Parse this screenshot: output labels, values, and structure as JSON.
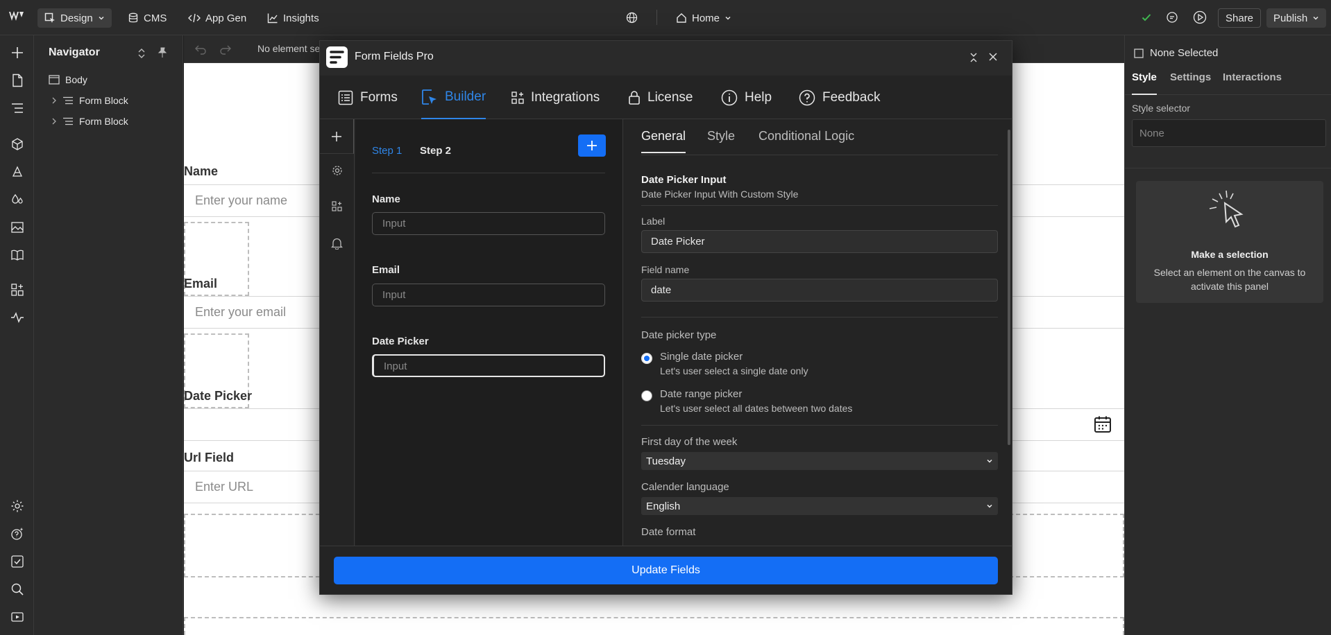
{
  "topbar": {
    "design_label": "Design",
    "cms_label": "CMS",
    "appgen_label": "App Gen",
    "insights_label": "Insights",
    "page_label": "Home",
    "share_label": "Share",
    "publish_label": "Publish"
  },
  "navigator": {
    "title": "Navigator",
    "items": [
      {
        "label": "Body"
      },
      {
        "label": "Form Block"
      },
      {
        "label": "Form Block"
      }
    ]
  },
  "canvas_toolbar": {
    "status": "No element se"
  },
  "canvas": {
    "name_label": "Name",
    "name_placeholder": "Enter your name",
    "email_label": "Email",
    "email_placeholder": "Enter your email",
    "date_label": "Date Picker",
    "url_label": "Url Field",
    "url_placeholder": "Enter URL"
  },
  "right_panel": {
    "selection": "None Selected",
    "tabs": [
      "Style",
      "Settings",
      "Interactions"
    ],
    "style_selector_label": "Style selector",
    "style_selector_value": "None",
    "empty_title": "Make a selection",
    "empty_text": "Select an element on the canvas to activate this panel"
  },
  "modal": {
    "title": "Form Fields Pro",
    "tabs": [
      {
        "label": "Forms"
      },
      {
        "label": "Builder"
      },
      {
        "label": "Integrations"
      },
      {
        "label": "License"
      },
      {
        "label": "Help"
      },
      {
        "label": "Feedback"
      }
    ],
    "steps": [
      "Step 1",
      "Step 2"
    ],
    "fields": [
      {
        "label": "Name",
        "placeholder": "Input"
      },
      {
        "label": "Email",
        "placeholder": "Input"
      },
      {
        "label": "Date Picker",
        "placeholder": "Input"
      }
    ],
    "settings_tabs": [
      "General",
      "Style",
      "Conditional Logic"
    ],
    "section_title": "Date Picker Input",
    "section_subtitle": "Date Picker Input With Custom Style",
    "label_caption": "Label",
    "label_value": "Date Picker",
    "fieldname_caption": "Field name",
    "fieldname_value": "date",
    "picker_type_caption": "Date picker type",
    "options": [
      {
        "title": "Single date picker",
        "desc": "Let's user select a single date only",
        "selected": true
      },
      {
        "title": "Date range picker",
        "desc": "Let's user select all dates between two dates",
        "selected": false
      }
    ],
    "first_day_caption": "First day of the week",
    "first_day_value": "Tuesday",
    "language_caption": "Calender language",
    "language_value": "English",
    "date_format_caption": "Date format",
    "update_button": "Update Fields"
  },
  "colors": {
    "accent": "#146ef5",
    "active_tab": "#2f86e8",
    "check": "#3fb950"
  }
}
